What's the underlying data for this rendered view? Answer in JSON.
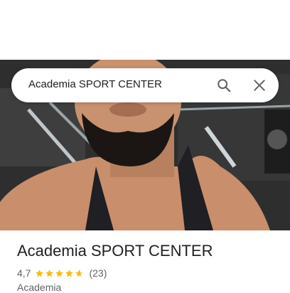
{
  "search": {
    "query": "Academia SPORT CENTER"
  },
  "icons": {
    "search": "search-icon",
    "close": "close-icon",
    "star": "star-icon"
  },
  "place": {
    "name": "Academia SPORT CENTER",
    "rating": "4,7",
    "rating_value": 4.7,
    "max_rating": 5,
    "review_count": "(23)",
    "category": "Academia"
  },
  "colors": {
    "star": "#fbbc04",
    "star_empty": "#dadce0",
    "text_primary": "#202124",
    "text_secondary": "#5f6368"
  }
}
